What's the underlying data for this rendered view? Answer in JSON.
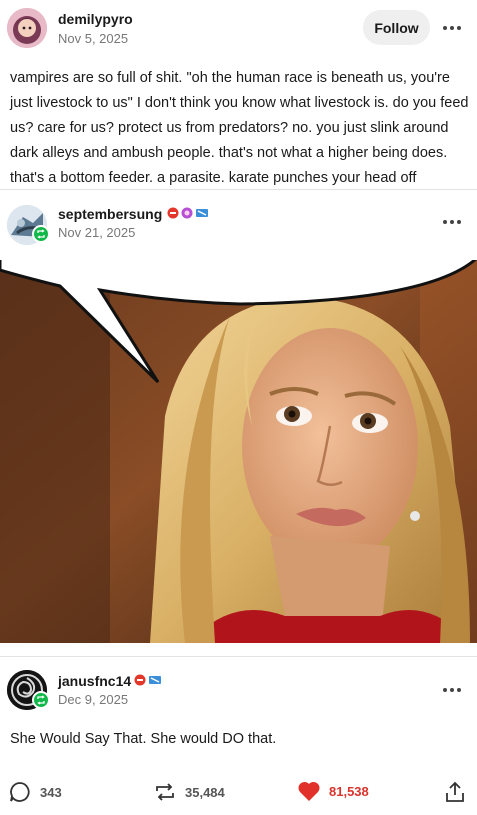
{
  "original_post": {
    "username": "demilypyro",
    "date": "Nov 5, 2025",
    "follow_label": "Follow",
    "text": "vampires are so full of shit. \"oh the human race is beneath us, you're just livestock to us\" I don't think you know what livestock is. do you feed us? care for us? protect us from predators? no. you just slink around dark alleys and ambush people. that's not what a higher being does. that's a bottom feeder. a parasite. karate punches your head off"
  },
  "reblog_1": {
    "username": "septembersung",
    "date": "Nov 21, 2025"
  },
  "reblog_2": {
    "username": "janusfnc14",
    "date": "Dec 9, 2025",
    "text": "She Would Say That. She would DO that."
  },
  "actions": {
    "replies": "343",
    "reblogs": "35,484",
    "likes": "81,538"
  },
  "colors": {
    "reblog_green": "#13b84a",
    "like_red": "#e0322a",
    "follow_bg": "#efefef"
  },
  "icons": [
    "more-icon",
    "reblog-icon",
    "reply-icon",
    "heart-icon",
    "share-icon"
  ]
}
